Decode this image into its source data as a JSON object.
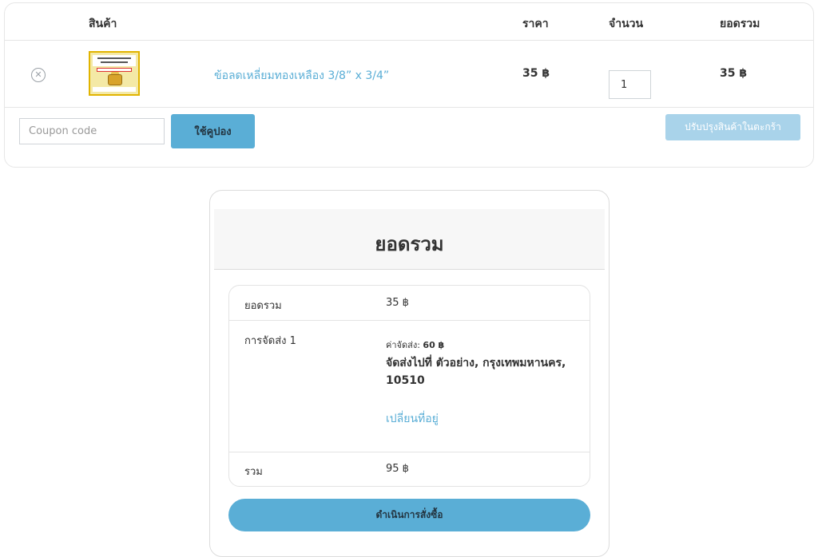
{
  "cart": {
    "headers": {
      "product": "สินค้า",
      "price": "ราคา",
      "quantity": "จำนวน",
      "subtotal": "ยอดรวม"
    },
    "item": {
      "name": "ข้อลดเหลี่ยมทองเหลือง 3/8” x 3/4”",
      "price": "35 ฿",
      "quantity": "1",
      "subtotal": "35 ฿"
    },
    "coupon_placeholder": "Coupon code",
    "apply_coupon_label": "ใช้คูปอง",
    "update_cart_label": "ปรับปรุงสินค้าในตะกร้า"
  },
  "totals": {
    "title": "ยอดรวม",
    "subtotal_label": "ยอดรวม",
    "subtotal_value": "35 ฿",
    "shipping_label": "การจัดส่ง 1",
    "shipping_fee_prefix": "ค่าจัดส่ง:",
    "shipping_fee_value": "60 ฿",
    "shipping_address": "จัดส่งไปที่ ตัวอย่าง, กรุงเทพมหานคร, 10510",
    "change_address_label": "เปลี่ยนที่อยู่",
    "total_label": "รวม",
    "total_value": "95 ฿",
    "checkout_label": "ดำเนินการสั่งซื้อ"
  },
  "colors": {
    "accent": "#5aaed6",
    "accent_light": "#a9d3ea"
  }
}
